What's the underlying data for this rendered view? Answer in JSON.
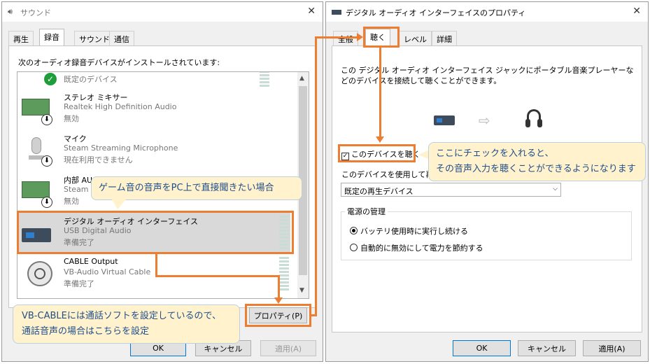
{
  "left_window": {
    "title": "サウンド",
    "tabs": [
      "再生",
      "録音",
      "サウンド",
      "通信"
    ],
    "heading": "次のオーディオ録音デバイスがインストールされています:",
    "devices": [
      {
        "name": "",
        "desc": "",
        "status": "既定のデバイス"
      },
      {
        "name": "ステレオ ミキサー",
        "desc": "Realtek High Definition Audio",
        "status": "無効"
      },
      {
        "name": "マイク",
        "desc": "Steam Streaming Microphone",
        "status": "現在利用できません"
      },
      {
        "name": "内部 AU",
        "desc": "Steam S",
        "status": "無効"
      },
      {
        "name": "デジタル オーディオ インターフェイス",
        "desc": "USB Digital Audio",
        "status": "準備完了"
      },
      {
        "name": "CABLE Output",
        "desc": "VB-Audio Virtual Cable",
        "status": "準備完了"
      }
    ],
    "properties_button": "プロパティ(P)",
    "ok_button": "OK",
    "cancel_button": "キャンセル",
    "apply_button": "適用(A)"
  },
  "right_window": {
    "title": "デジタル オーディオ インターフェイスのプロパティ",
    "tabs": [
      "全般",
      "聴く",
      "レベル",
      "詳細"
    ],
    "description": "この デジタル オーディオ インターフェイス ジャックにポータブル音楽プレーヤーなどのデバイスを接続して聴くことができます。",
    "listen_checkbox": "このデバイスを聴く",
    "playback_label": "このデバイスを使用して再生",
    "playback_select": "既定の再生デバイス",
    "power_group": "電源の管理",
    "power_option_1": "バッテリ使用時に実行し続ける",
    "power_option_2": "自動的に無効にして電力を節約する",
    "ok_button": "OK",
    "cancel_button": "キャンセル",
    "apply_button": "適用(A)"
  },
  "callouts": {
    "game_audio": "ゲーム音の音声をPC上で直接聞きたい場合",
    "vb_cable_line1": "VB-CABLEには通話ソフトを設定しているので、",
    "vb_cable_line2": "通話音声の場合はこちらを設定",
    "check_line1": "ここにチェックを入れると、",
    "check_line2": "その音声入力を聴くことができるようになります"
  },
  "colors": {
    "accent": "#ed7d31",
    "callout_bg": "#fff2cc",
    "callout_text": "#1f4e8c",
    "selected_row": "#d9d9d9"
  }
}
